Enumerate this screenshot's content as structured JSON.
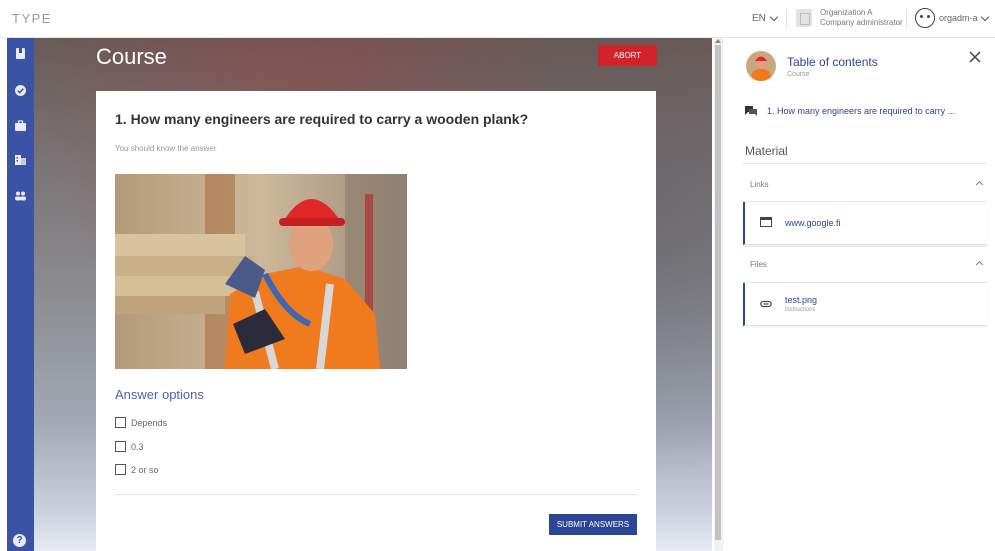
{
  "app": {
    "brand": "TYPE"
  },
  "topbar": {
    "language": "EN",
    "organization": {
      "name": "Organization A",
      "role": "Company administrator"
    },
    "user": "orgadm-a"
  },
  "sidebar": {
    "items": [
      {
        "icon": "book-icon"
      },
      {
        "icon": "check-circle-icon"
      },
      {
        "icon": "briefcase-icon"
      },
      {
        "icon": "building-icon"
      },
      {
        "icon": "people-icon"
      }
    ],
    "help_icon": "help-icon",
    "help_label": "?"
  },
  "course": {
    "title": "Course",
    "abort_label": "ABORT"
  },
  "question": {
    "title": "1. How many engineers are required to carry a wooden plank?",
    "subtitle": "You should know the answer",
    "image_icon": "engineer-photo",
    "answer_options_title": "Answer options",
    "options": [
      {
        "label": "Depends",
        "checked": false
      },
      {
        "label": "0.3",
        "checked": false
      },
      {
        "label": "2 or so",
        "checked": false
      }
    ],
    "submit_label": "SUBMIT ANSWERS"
  },
  "toc": {
    "title": "Table of contents",
    "subtitle": "Course",
    "items": [
      {
        "icon": "chat-icon",
        "label": "1. How many engineers are required to carry ..."
      }
    ]
  },
  "material": {
    "title": "Material",
    "sections": [
      {
        "label": "Links",
        "items": [
          {
            "icon": "browser-icon",
            "label": "www.google.fi",
            "description": ""
          }
        ]
      },
      {
        "label": "Files",
        "items": [
          {
            "icon": "paperclip-icon",
            "label": "test.png",
            "description": "instructions"
          }
        ]
      }
    ]
  },
  "colors": {
    "primary": "#2d4595",
    "sidebar": "#3a53a4",
    "abort": "#d2232a",
    "helmet": "#e02828",
    "vest": "#f07a1e"
  }
}
